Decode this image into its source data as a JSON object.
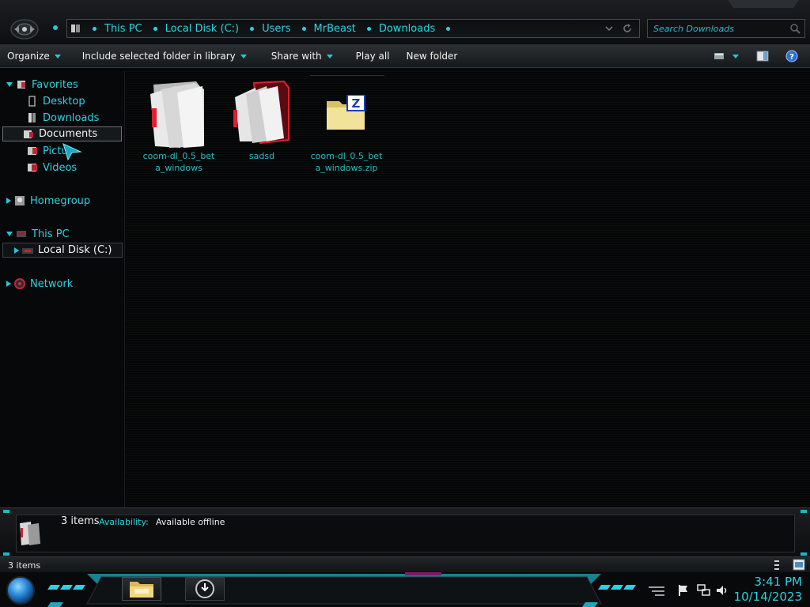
{
  "address": {
    "crumbs": [
      "This PC",
      "Local Disk (C:)",
      "Users",
      "MrBeast",
      "Downloads"
    ]
  },
  "search": {
    "placeholder": "Search Downloads"
  },
  "toolbar": {
    "organize": "Organize",
    "include_library": "Include selected folder in library",
    "share_with": "Share with",
    "play_all": "Play all",
    "new_folder": "New folder",
    "help": "?"
  },
  "nav": {
    "favorites": "Favorites",
    "desktop": "Desktop",
    "downloads": "Downloads",
    "documents": "Documents",
    "pictures": "Pictu",
    "videos": "Videos",
    "homegroup": "Homegroup",
    "this_pc": "This PC",
    "local_disk": "Local Disk (C:)",
    "network": "Network"
  },
  "files": [
    {
      "name": "coom-dl_0.5_beta_windows",
      "icon": "folder-icon"
    },
    {
      "name": "sadsd",
      "icon": "folder-icon"
    },
    {
      "name": "coom-dl_0.5_beta_windows.zip",
      "icon": "zip-archive-icon"
    }
  ],
  "details": {
    "count": "3 items",
    "availability_label": "Availability:",
    "availability_value": "Available offline"
  },
  "status": {
    "count": "3 items"
  },
  "clock": {
    "time": "3:41 PM",
    "date": "10/14/2023"
  },
  "colors": {
    "accent": "#2cd1e2",
    "background": "#060708"
  }
}
